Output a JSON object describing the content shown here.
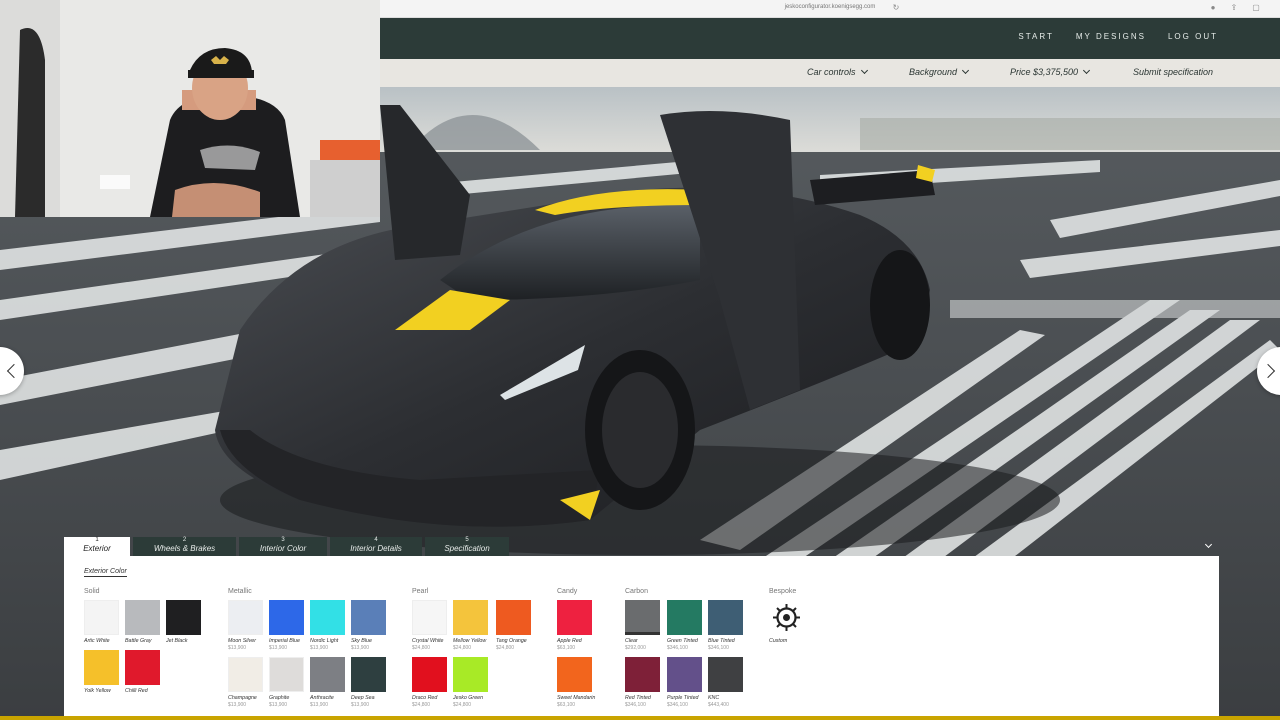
{
  "browser": {
    "url": "jeskoconfigurator.koenigsegg.com"
  },
  "nav": {
    "start": "START",
    "my_designs": "MY DESIGNS",
    "logout": "LOG OUT"
  },
  "subnav": {
    "car_controls": "Car controls",
    "background": "Background",
    "price": "Price $3,375,500",
    "submit": "Submit specification"
  },
  "tabs": [
    {
      "num": "1",
      "label": "Exterior",
      "active": true
    },
    {
      "num": "2",
      "label": "Wheels & Brakes"
    },
    {
      "num": "3",
      "label": "Interior Color"
    },
    {
      "num": "4",
      "label": "Interior Details"
    },
    {
      "num": "5",
      "label": "Specification"
    }
  ],
  "panel": {
    "subtab_active": "Exterior Color",
    "groups": {
      "solid": "Solid",
      "metallic": "Metallic",
      "pearl": "Pearl",
      "candy": "Candy",
      "carbon": "Carbon",
      "bespoke": "Bespoke"
    },
    "swatches": {
      "artic_white": {
        "name": "Artic White",
        "color": "#f4f4f4"
      },
      "battle_gray": {
        "name": "Battle Gray",
        "color": "#b8babd"
      },
      "jet_black": {
        "name": "Jet Black",
        "color": "#1f1f21"
      },
      "yolk_yellow": {
        "name": "Yolk Yellow",
        "color": "#f5c02a"
      },
      "chilli_red": {
        "name": "Chilli Red",
        "color": "#e0192c"
      },
      "moon_silver": {
        "name": "Moon Silver",
        "price": "$13,900",
        "color": "#eceef2"
      },
      "imperial_blue": {
        "name": "Imperial Blue",
        "price": "$13,900",
        "color": "#2d68e8"
      },
      "nordic_light": {
        "name": "Nordic Light",
        "price": "$13,900",
        "color": "#32e0e6"
      },
      "sky_blue": {
        "name": "Sky Blue",
        "price": "$13,900",
        "color": "#5a7fb8"
      },
      "champagne": {
        "name": "Champagne",
        "price": "$13,900",
        "color": "#f1ede6"
      },
      "graphite": {
        "name": "Graphite",
        "price": "$13,900",
        "color": "#dedcda"
      },
      "anthracite": {
        "name": "Anthracite",
        "price": "$13,900",
        "color": "#7d7f84"
      },
      "deep_sea": {
        "name": "Deep Sea",
        "price": "$13,900",
        "color": "#2e3f40"
      },
      "crystal_white": {
        "name": "Crystal White",
        "price": "$24,800",
        "color": "#f6f6f6"
      },
      "mellow_yellow": {
        "name": "Mellow Yellow",
        "price": "$24,800",
        "color": "#f4c43c"
      },
      "tang_orange": {
        "name": "Tang Orange",
        "price": "$24,800",
        "color": "#ee5a20"
      },
      "draco_red": {
        "name": "Draco Red",
        "price": "$24,800",
        "color": "#e1101e"
      },
      "jesko_green": {
        "name": "Jesko Green",
        "price": "$24,800",
        "color": "#a8ea26"
      },
      "apple_red": {
        "name": "Apple Red",
        "price": "$63,100",
        "color": "#ee2140"
      },
      "sweet_mandarin": {
        "name": "Sweet Mandarin",
        "price": "$63,100",
        "color": "#f2651d"
      },
      "clear": {
        "name": "Clear",
        "price": "$292,000",
        "color": "#6a6c6e"
      },
      "green_tinted": {
        "name": "Green Tinted",
        "price": "$346,100",
        "color": "#247a62"
      },
      "blue_tinted": {
        "name": "Blue Tinted",
        "price": "$346,100",
        "color": "#3e5e74"
      },
      "red_tinted": {
        "name": "Red Tinted",
        "price": "$346,100",
        "color": "#7e2038"
      },
      "purple_tinted": {
        "name": "Purple Tinted",
        "price": "$346,100",
        "color": "#63508a"
      },
      "knc": {
        "name": "KNC",
        "price": "$443,400",
        "color": "#3f4042"
      },
      "custom": {
        "name": "Custom"
      }
    }
  },
  "colors": {
    "header": "#2c3b38",
    "accent_yellow": "#f2d021",
    "body": "#2b2d31"
  }
}
